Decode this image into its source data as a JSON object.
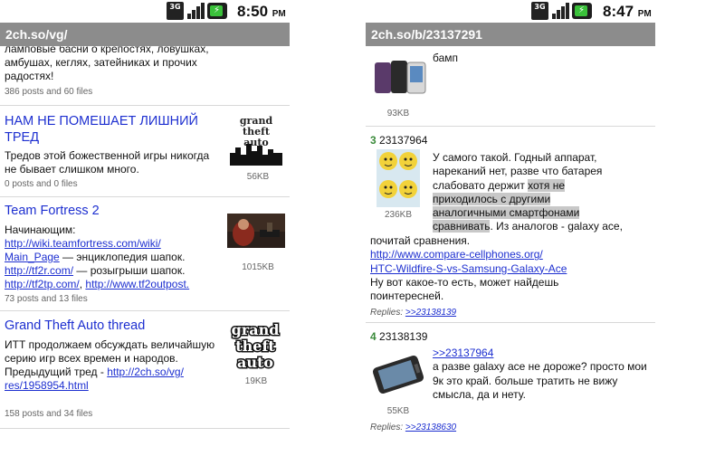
{
  "left": {
    "status": {
      "time": "8:50",
      "ampm": "PM",
      "network": "3G"
    },
    "title": "2ch.so/vg/",
    "threads": [
      {
        "title": "",
        "text": "ламповые басни о крепостях, ловушках, амбушах, кеглях, затейниках и прочих радостях!",
        "meta": "386 posts and 60 files"
      },
      {
        "title": "НАМ НЕ ПОМЕШАЕТ ЛИШНИЙ ТРЕД",
        "text": "Тредов этой божественной игры никогда не бывает слишком много.",
        "meta": "0 posts and 0 files",
        "size": "56KB",
        "thumb": "gta-logo-image"
      },
      {
        "title": "Team Fortress 2",
        "text_lines": [
          {
            "prefix": "Начинающим:",
            "link": "",
            "suffix": ""
          },
          {
            "prefix": "",
            "link": "http://wiki.teamfortress.com/wiki/",
            "suffix": ""
          },
          {
            "prefix": "",
            "link": "Main_Page",
            "suffix": " — энциклопедия шапок."
          },
          {
            "prefix": "",
            "link": "http://tf2r.com/",
            "suffix": " — розыгрыши шапок."
          },
          {
            "prefix": "",
            "link": "http://tf2tp.com/",
            "suffix": ", ",
            "link2": "http://www.tf2outpost."
          }
        ],
        "meta": "73 posts and 13 files",
        "size": "1015KB",
        "thumb": "tf2-image"
      },
      {
        "title": "Grand Theft Auto thread",
        "text": "ИТТ продолжаем обсуждать величайшую серию игр всех времен и народов.",
        "text_prefix": "Предыдущий тред - ",
        "link1": "http://2ch.so/vg/",
        "link2": "res/1958954.html",
        "meta": "158 posts and 34 files",
        "size": "19KB",
        "thumb": "gta-logo-image"
      }
    ],
    "gta_logo": [
      "grand",
      "theft",
      "auto"
    ]
  },
  "right": {
    "status": {
      "time": "8:47",
      "ampm": "PM",
      "network": "3G"
    },
    "title": "2ch.so/b/23137291",
    "posts": [
      {
        "text": "бамп",
        "size": "93KB",
        "thumb": "phones-image"
      },
      {
        "index": "3",
        "id": "23137964",
        "size": "236KB",
        "thumb": "smileys-image",
        "lines": [
          "У самого такой. Годный аппарат,",
          "нареканий нет, разве что батарея",
          "слабовато держит ",
          "хотя не",
          "приходилось с другими",
          "аналогичными смартфонами",
          "сравнивать",
          ". Из аналогов - galaxy ace,",
          "почитай сравнения."
        ],
        "link1": "http://www.compare-cellphones.org/",
        "link2": "HTC-Wildfire-S-vs-Samsung-Galaxy-Ace",
        "after": "Ну вот какое-то есть, может найдешь поинтересней.",
        "replies_label": "Replies: ",
        "replies_link": ">>23138139"
      },
      {
        "index": "4",
        "id": "23138139",
        "size": "55KB",
        "thumb": "phone-image",
        "quote": ">>23137964",
        "text": "а разве galaxy ace не дороже? просто мои 9к это край. больше тратить не вижу смысла, да и нету.",
        "replies_label": "Replies: ",
        "replies_link": ">>23138630"
      }
    ]
  }
}
